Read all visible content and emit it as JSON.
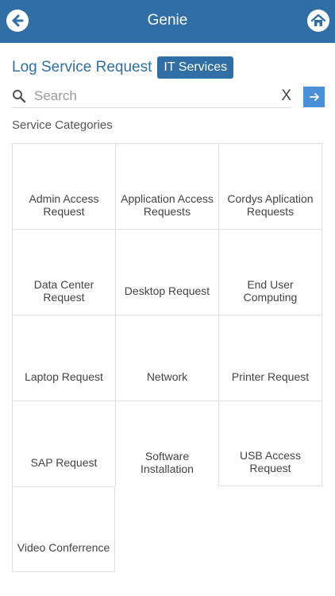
{
  "header": {
    "title": "Genie",
    "back_icon": "arrow-left-circle-icon",
    "home_icon": "home-icon",
    "color": "#2f6fa6"
  },
  "page": {
    "title": "Log Service Request",
    "badge": "IT Services"
  },
  "search": {
    "placeholder": "Search",
    "value": "",
    "clear_label": "X",
    "icon": "search-icon",
    "go_icon": "arrow-right-icon"
  },
  "categories": {
    "label": "Service Categories",
    "items": [
      {
        "label": "Admin Access Request"
      },
      {
        "label": "Application Access Requests"
      },
      {
        "label": "Cordys Aplication Requests"
      },
      {
        "label": "Data Center Request"
      },
      {
        "label": "Desktop Request"
      },
      {
        "label": "End User Computing"
      },
      {
        "label": "Laptop Request"
      },
      {
        "label": "Network"
      },
      {
        "label": "Printer Request"
      },
      {
        "label": "SAP Request"
      },
      {
        "label": "Software Installation"
      },
      {
        "label": "USB Access Request"
      },
      {
        "label": "Video Conferrence"
      }
    ]
  }
}
